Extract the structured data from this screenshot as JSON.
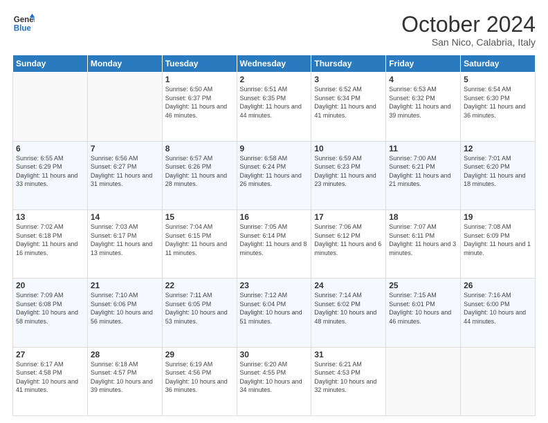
{
  "logo": {
    "line1": "General",
    "line2": "Blue"
  },
  "title": "October 2024",
  "subtitle": "San Nico, Calabria, Italy",
  "weekdays": [
    "Sunday",
    "Monday",
    "Tuesday",
    "Wednesday",
    "Thursday",
    "Friday",
    "Saturday"
  ],
  "weeks": [
    [
      {
        "day": "",
        "info": ""
      },
      {
        "day": "",
        "info": ""
      },
      {
        "day": "1",
        "info": "Sunrise: 6:50 AM\nSunset: 6:37 PM\nDaylight: 11 hours and 46 minutes."
      },
      {
        "day": "2",
        "info": "Sunrise: 6:51 AM\nSunset: 6:35 PM\nDaylight: 11 hours and 44 minutes."
      },
      {
        "day": "3",
        "info": "Sunrise: 6:52 AM\nSunset: 6:34 PM\nDaylight: 11 hours and 41 minutes."
      },
      {
        "day": "4",
        "info": "Sunrise: 6:53 AM\nSunset: 6:32 PM\nDaylight: 11 hours and 39 minutes."
      },
      {
        "day": "5",
        "info": "Sunrise: 6:54 AM\nSunset: 6:30 PM\nDaylight: 11 hours and 36 minutes."
      }
    ],
    [
      {
        "day": "6",
        "info": "Sunrise: 6:55 AM\nSunset: 6:29 PM\nDaylight: 11 hours and 33 minutes."
      },
      {
        "day": "7",
        "info": "Sunrise: 6:56 AM\nSunset: 6:27 PM\nDaylight: 11 hours and 31 minutes."
      },
      {
        "day": "8",
        "info": "Sunrise: 6:57 AM\nSunset: 6:26 PM\nDaylight: 11 hours and 28 minutes."
      },
      {
        "day": "9",
        "info": "Sunrise: 6:58 AM\nSunset: 6:24 PM\nDaylight: 11 hours and 26 minutes."
      },
      {
        "day": "10",
        "info": "Sunrise: 6:59 AM\nSunset: 6:23 PM\nDaylight: 11 hours and 23 minutes."
      },
      {
        "day": "11",
        "info": "Sunrise: 7:00 AM\nSunset: 6:21 PM\nDaylight: 11 hours and 21 minutes."
      },
      {
        "day": "12",
        "info": "Sunrise: 7:01 AM\nSunset: 6:20 PM\nDaylight: 11 hours and 18 minutes."
      }
    ],
    [
      {
        "day": "13",
        "info": "Sunrise: 7:02 AM\nSunset: 6:18 PM\nDaylight: 11 hours and 16 minutes."
      },
      {
        "day": "14",
        "info": "Sunrise: 7:03 AM\nSunset: 6:17 PM\nDaylight: 11 hours and 13 minutes."
      },
      {
        "day": "15",
        "info": "Sunrise: 7:04 AM\nSunset: 6:15 PM\nDaylight: 11 hours and 11 minutes."
      },
      {
        "day": "16",
        "info": "Sunrise: 7:05 AM\nSunset: 6:14 PM\nDaylight: 11 hours and 8 minutes."
      },
      {
        "day": "17",
        "info": "Sunrise: 7:06 AM\nSunset: 6:12 PM\nDaylight: 11 hours and 6 minutes."
      },
      {
        "day": "18",
        "info": "Sunrise: 7:07 AM\nSunset: 6:11 PM\nDaylight: 11 hours and 3 minutes."
      },
      {
        "day": "19",
        "info": "Sunrise: 7:08 AM\nSunset: 6:09 PM\nDaylight: 11 hours and 1 minute."
      }
    ],
    [
      {
        "day": "20",
        "info": "Sunrise: 7:09 AM\nSunset: 6:08 PM\nDaylight: 10 hours and 58 minutes."
      },
      {
        "day": "21",
        "info": "Sunrise: 7:10 AM\nSunset: 6:06 PM\nDaylight: 10 hours and 56 minutes."
      },
      {
        "day": "22",
        "info": "Sunrise: 7:11 AM\nSunset: 6:05 PM\nDaylight: 10 hours and 53 minutes."
      },
      {
        "day": "23",
        "info": "Sunrise: 7:12 AM\nSunset: 6:04 PM\nDaylight: 10 hours and 51 minutes."
      },
      {
        "day": "24",
        "info": "Sunrise: 7:14 AM\nSunset: 6:02 PM\nDaylight: 10 hours and 48 minutes."
      },
      {
        "day": "25",
        "info": "Sunrise: 7:15 AM\nSunset: 6:01 PM\nDaylight: 10 hours and 46 minutes."
      },
      {
        "day": "26",
        "info": "Sunrise: 7:16 AM\nSunset: 6:00 PM\nDaylight: 10 hours and 44 minutes."
      }
    ],
    [
      {
        "day": "27",
        "info": "Sunrise: 6:17 AM\nSunset: 4:58 PM\nDaylight: 10 hours and 41 minutes."
      },
      {
        "day": "28",
        "info": "Sunrise: 6:18 AM\nSunset: 4:57 PM\nDaylight: 10 hours and 39 minutes."
      },
      {
        "day": "29",
        "info": "Sunrise: 6:19 AM\nSunset: 4:56 PM\nDaylight: 10 hours and 36 minutes."
      },
      {
        "day": "30",
        "info": "Sunrise: 6:20 AM\nSunset: 4:55 PM\nDaylight: 10 hours and 34 minutes."
      },
      {
        "day": "31",
        "info": "Sunrise: 6:21 AM\nSunset: 4:53 PM\nDaylight: 10 hours and 32 minutes."
      },
      {
        "day": "",
        "info": ""
      },
      {
        "day": "",
        "info": ""
      }
    ]
  ]
}
